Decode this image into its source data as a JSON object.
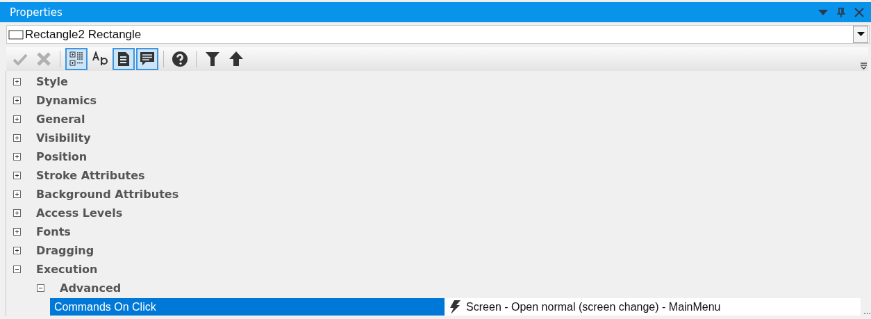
{
  "window": {
    "title": "Properties"
  },
  "object_selector": {
    "value": "Rectangle2 Rectangle"
  },
  "toolbar": [
    {
      "kind": "apply",
      "disabled": true,
      "selected": false
    },
    {
      "kind": "cancel",
      "disabled": true,
      "selected": false
    },
    {
      "kind": "categorized",
      "disabled": false,
      "selected": true
    },
    {
      "kind": "alphabetical",
      "disabled": false,
      "selected": false
    },
    {
      "kind": "description",
      "disabled": false,
      "selected": true
    },
    {
      "kind": "comments",
      "disabled": false,
      "selected": true
    },
    {
      "kind": "help",
      "disabled": false,
      "selected": false
    },
    {
      "kind": "filter",
      "disabled": false,
      "selected": false
    },
    {
      "kind": "up",
      "disabled": false,
      "selected": false
    }
  ],
  "tree": [
    {
      "kind": "category",
      "label": "Style",
      "expanded": false
    },
    {
      "kind": "category",
      "label": "Dynamics",
      "expanded": false
    },
    {
      "kind": "category",
      "label": "General",
      "expanded": false
    },
    {
      "kind": "category",
      "label": "Visibility",
      "expanded": false
    },
    {
      "kind": "category",
      "label": "Position",
      "expanded": false
    },
    {
      "kind": "category",
      "label": "Stroke Attributes",
      "expanded": false
    },
    {
      "kind": "category",
      "label": "Background Attributes",
      "expanded": false
    },
    {
      "kind": "category",
      "label": "Access Levels",
      "expanded": false
    },
    {
      "kind": "category",
      "label": "Fonts",
      "expanded": false
    },
    {
      "kind": "category",
      "label": "Dragging",
      "expanded": false
    },
    {
      "kind": "category",
      "label": "Execution",
      "expanded": true,
      "children": [
        {
          "kind": "category",
          "label": "Advanced",
          "expanded": true,
          "children": [
            {
              "kind": "property",
              "label": "Commands On Click",
              "selected": true,
              "value": "Screen - Open normal (screen change) - MainMenu",
              "button": "..."
            }
          ]
        }
      ]
    }
  ]
}
